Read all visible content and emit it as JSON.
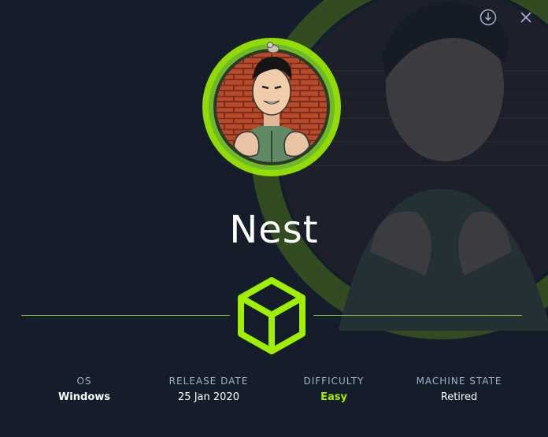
{
  "machine": {
    "name": "Nest"
  },
  "actions": {
    "download_icon": "download-icon",
    "close_icon": "close-icon"
  },
  "stats": [
    {
      "label": "OS",
      "value": "Windows"
    },
    {
      "label": "RELEASE DATE",
      "value": "25 Jan 2020"
    },
    {
      "label": "DIFFICULTY",
      "value": "Easy"
    },
    {
      "label": "MACHINE STATE",
      "value": "Retired"
    }
  ],
  "colors": {
    "background": "#151d2a",
    "accent_green": "#9fef00",
    "rule_green": "#8ac73e",
    "label_gray": "#a4b1cd",
    "easy": "#9fef00"
  }
}
